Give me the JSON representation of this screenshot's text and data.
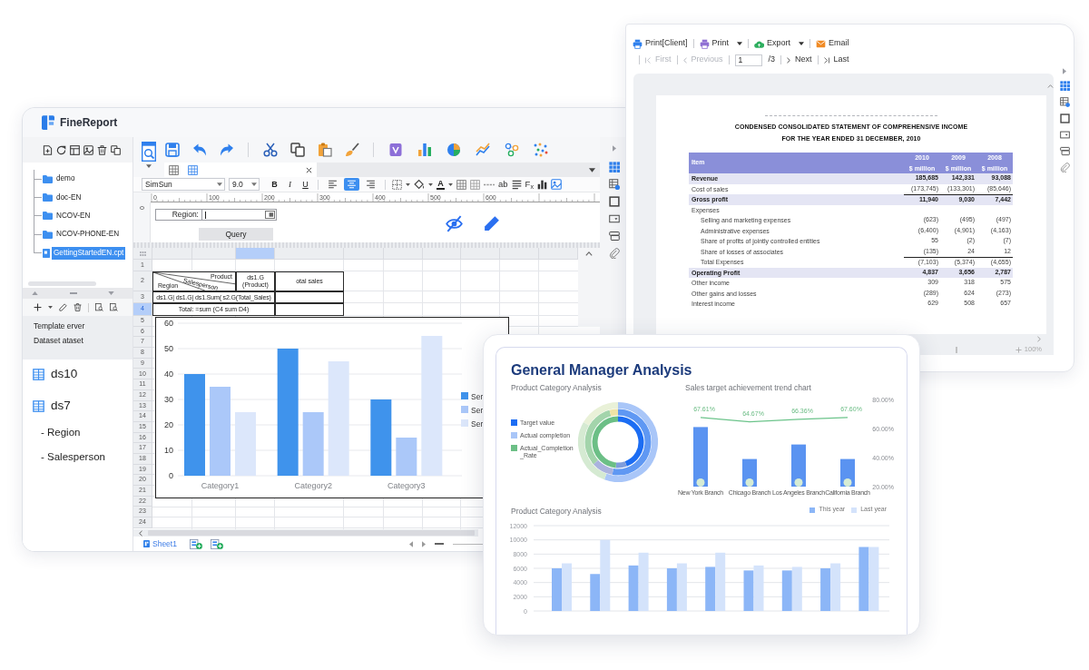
{
  "designer": {
    "app_name": "FineReport",
    "files": [
      {
        "label": "demo",
        "kind": "folder",
        "selected": false
      },
      {
        "label": "doc-EN",
        "kind": "folder",
        "selected": false
      },
      {
        "label": "NCOV-EN",
        "kind": "folder",
        "selected": false
      },
      {
        "label": "NCOV-PHONE-EN",
        "kind": "folder",
        "selected": false
      },
      {
        "label": "GettingStartedEN.cpt",
        "kind": "file",
        "selected": true
      }
    ],
    "data_panel": [
      "Template erver",
      "Dataset ataset"
    ],
    "datasets": [
      {
        "label": "ds10"
      },
      {
        "label": "ds7",
        "children": [
          {
            "label": "- Region"
          },
          {
            "label": "- Salesperson"
          }
        ]
      }
    ],
    "font_family": "SimSun",
    "font_size": "9.0",
    "style_buttons": [
      "B",
      "I",
      "U"
    ],
    "alignments": [
      {
        "selected": false
      },
      {
        "selected": true
      },
      {
        "selected": false
      }
    ],
    "text_color_button": "A",
    "glyph_buttons": [
      "ab",
      "F$_{x}$"
    ],
    "ruler": [
      "0",
      "100",
      "200",
      "300",
      "400",
      "500",
      "600"
    ],
    "vertical_ruler": "0",
    "parameter": {
      "label": "Region:",
      "button": "Query"
    },
    "columns": [
      {
        "selected": false
      },
      {
        "selected": false
      },
      {
        "selected": true
      },
      {
        "selected": false
      },
      {
        "selected": false
      },
      {
        "selected": false
      },
      {
        "selected": false
      },
      {
        "selected": false
      },
      {
        "selected": false
      },
      {
        "selected": false
      }
    ],
    "rows": [
      {
        "label": "1",
        "selected": false
      },
      {
        "label": "2",
        "selected": false
      },
      {
        "label": "3",
        "selected": false
      },
      {
        "label": "4",
        "selected": true
      },
      {
        "label": "5",
        "selected": false
      },
      {
        "label": "6",
        "selected": false
      },
      {
        "label": "7",
        "selected": false
      },
      {
        "label": "8",
        "selected": false
      },
      {
        "label": "9",
        "selected": false
      },
      {
        "label": "10",
        "selected": false
      },
      {
        "label": "11",
        "selected": false
      },
      {
        "label": "12",
        "selected": false
      },
      {
        "label": "13",
        "selected": false
      },
      {
        "label": "14",
        "selected": false
      },
      {
        "label": "15",
        "selected": false
      },
      {
        "label": "16",
        "selected": false
      },
      {
        "label": "17",
        "selected": false
      },
      {
        "label": "18",
        "selected": false
      },
      {
        "label": "19",
        "selected": false
      },
      {
        "label": "20",
        "selected": false
      },
      {
        "label": "21",
        "selected": false
      },
      {
        "label": "22",
        "selected": false
      },
      {
        "label": "23",
        "selected": false
      },
      {
        "label": "24",
        "selected": false
      }
    ],
    "cells": {
      "header_top": "Product",
      "header_diagonal": "Salesperson",
      "header_bottom": "Region",
      "group_cell": "ds1.G (Product)",
      "sum_cell": "otal sales",
      "formula_row": "ds1.G| ds1.G| ds1.Sum( s2.G(Total_Sales)",
      "total_row": "Total: =sum (C4 sum D4)"
    },
    "chart_data": {
      "type": "bar",
      "categories": [
        "Category1",
        "Category2",
        "Category3"
      ],
      "series": [
        {
          "name": "Ser",
          "color": "#3f93ec",
          "values": [
            40,
            50,
            30
          ]
        },
        {
          "name": "Ser",
          "color": "#abc8f9",
          "values": [
            35,
            25,
            15
          ]
        },
        {
          "name": "Ser",
          "color": "#dce7fb",
          "values": [
            25,
            45,
            55
          ]
        }
      ],
      "ylim": [
        0,
        60
      ],
      "yticks": [
        0,
        10,
        20,
        30,
        40,
        50,
        60
      ],
      "grid": true,
      "legend": "right"
    },
    "sheet_tab": "Sheet1"
  },
  "viewer": {
    "toolbar": [
      {
        "label": "Print[Client]",
        "dropdown": false
      },
      {
        "label": "Print",
        "dropdown": true
      },
      {
        "label": "Export",
        "dropdown": true
      },
      {
        "label": "Email",
        "dropdown": false
      }
    ],
    "pager": {
      "back": [
        {
          "label": "First",
          "disabled": true
        },
        {
          "label": "Previous",
          "disabled": true
        }
      ],
      "page": "1",
      "page_count": "/3",
      "forward": [
        {
          "label": "Next",
          "disabled": false
        },
        {
          "label": "Last",
          "disabled": false
        }
      ]
    },
    "report_title": "CONDENSED CONSOLIDATED STATEMENT OF COMPREHENSIVE INCOME",
    "report_subtitle": "FOR THE YEAR ENDED 31 DECEMBER, 2010",
    "table": {
      "item_header": "Item",
      "columns": [
        {
          "year": "2010",
          "unit": "$ million"
        },
        {
          "year": "2009",
          "unit": "$ million"
        },
        {
          "year": "2008",
          "unit": "$ million"
        }
      ],
      "rows": [
        {
          "label": "Revenue",
          "kind": "highlight",
          "ruled": false,
          "values": [
            "185,685",
            "142,331",
            "93,088"
          ]
        },
        {
          "label": "Cost of sales",
          "kind": "plain",
          "ruled": false,
          "values": [
            "(173,745)",
            "(133,301)",
            "(85,646)"
          ]
        },
        {
          "label": "Gross profit",
          "kind": "highlight",
          "ruled": true,
          "values": [
            "11,940",
            "9,030",
            "7,442"
          ]
        },
        {
          "label": "Expenses",
          "kind": "plain",
          "ruled": false,
          "children": [
            {
              "label": "Selling and marketing expenses",
              "kind": "plain",
              "ruled": false,
              "values": [
                "(623)",
                "(495)",
                "(497)"
              ]
            },
            {
              "label": "Administrative expenses",
              "kind": "plain",
              "ruled": false,
              "values": [
                "(6,400)",
                "(4,901)",
                "(4,163)"
              ]
            },
            {
              "label": "Share of profits of jointly controlled entities",
              "kind": "plain",
              "ruled": false,
              "values": [
                "55",
                "(2)",
                "(7)"
              ]
            },
            {
              "label": "Share of losses of associates",
              "kind": "plain",
              "ruled": false,
              "values": [
                "(135)",
                "24",
                "12"
              ]
            },
            {
              "label": "Total Expenses",
              "kind": "plain",
              "ruled": true,
              "values": [
                "(7,103)",
                "(5,374)",
                "(4,655)"
              ]
            }
          ]
        },
        {
          "label": "Operating Profit",
          "kind": "highlight",
          "ruled": false,
          "values": [
            "4,837",
            "3,656",
            "2,787"
          ]
        },
        {
          "label": "Other income",
          "kind": "plain",
          "ruled": false,
          "values": [
            "309",
            "318",
            "575"
          ]
        },
        {
          "label": "Other gains and losses",
          "kind": "plain",
          "ruled": false,
          "values": [
            "(289)",
            "624",
            "(273)"
          ]
        },
        {
          "label": "Interest income",
          "kind": "plain",
          "ruled": false,
          "values": [
            "629",
            "508",
            "657"
          ]
        }
      ]
    },
    "zoom": "100%"
  },
  "dashboard": {
    "title": "General Manager Analysis",
    "donut": {
      "title": "Product Category Analysis",
      "legend": [
        {
          "label": "Target value",
          "color": "#1c6df3"
        },
        {
          "label": "Actual completion",
          "color": "#a9c6f8"
        },
        {
          "label": "Actual_Completion _Rate",
          "color": "#6cbf86"
        }
      ]
    },
    "trend": {
      "title": "Sales target achievement trend chart",
      "chart_data": {
        "type": "bar",
        "categories": [
          "New York Branch",
          "Chicago Branch",
          "Los Angeles Branch",
          "California Branch"
        ],
        "series": [
          {
            "type": "bar",
            "color": "#5a93f1",
            "values": [
              61,
              39,
              49,
              39
            ]
          },
          {
            "type": "line",
            "color": "#6cc48b",
            "values": [
              67.61,
              64.67,
              66.36,
              67.6
            ]
          }
        ],
        "ylim": [
          20,
          80
        ],
        "yticks": [
          {
            "value": 20,
            "label": "20.00%"
          },
          {
            "value": 40,
            "label": "40.00%"
          },
          {
            "value": 60,
            "label": "60.00%"
          },
          {
            "value": 80,
            "label": "80.00%"
          }
        ],
        "value_labels": [
          "67.61%",
          "64.67%",
          "66.36%",
          "67.60%"
        ]
      }
    },
    "bars": {
      "title": "Product Category Analysis",
      "chart_data": {
        "type": "bar",
        "categories": [
          null,
          null,
          null,
          null,
          null,
          null,
          null,
          null,
          null
        ],
        "series": [
          {
            "name": "This year",
            "color": "#8cb6f7",
            "values": [
              6000,
              5200,
              6400,
              6000,
              6200,
              5700,
              5700,
              6000,
              9000
            ]
          },
          {
            "name": "Last year",
            "color": "#d4e3fb",
            "values": [
              6700,
              10000,
              8200,
              6700,
              8200,
              6400,
              6200,
              6700,
              9000
            ]
          }
        ],
        "ylim": [
          0,
          12000
        ],
        "yticks": [
          0,
          2000,
          4000,
          6000,
          8000,
          10000,
          12000
        ],
        "grid": true,
        "legend": "top-right"
      }
    }
  }
}
